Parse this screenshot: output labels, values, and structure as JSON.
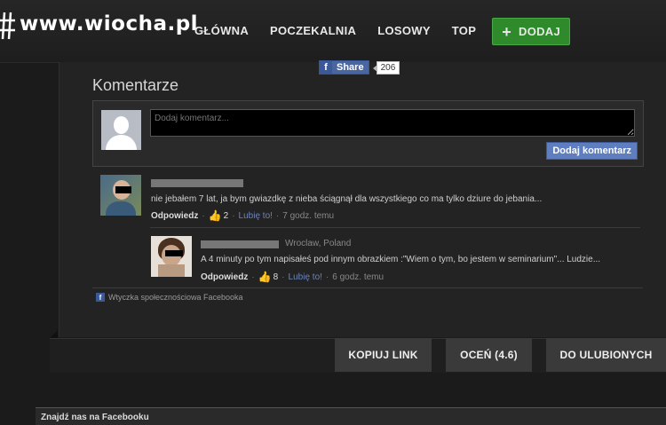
{
  "header": {
    "logo": "www.wiocha.pl",
    "nav": [
      "GŁÓWNA",
      "POCZEKALNIA",
      "LOSOWY",
      "TOP"
    ],
    "add_label": "DODAJ",
    "add_icon": "plus-icon"
  },
  "share": {
    "label": "Share",
    "count": "206",
    "icon": "facebook-icon"
  },
  "comments": {
    "title": "Komentarze",
    "placeholder": "Dodaj komentarz...",
    "submit_label": "Dodaj komentarz",
    "items": [
      {
        "text": "nie jebałem 7 lat, ja bym gwiazdkę z nieba ściągnął dla wszystkiego co ma tylko dziure do jebania...",
        "reply": "Odpowiedz",
        "likes": "2",
        "like_label": "Lubię to!",
        "time": "7 godz. temu"
      },
      {
        "location": "Wroclaw, Poland",
        "text": "A 4 minuty po tym napisałeś pod innym obrazkiem :\"Wiem o tym, bo jestem w seminarium\"... Ludzie...",
        "reply": "Odpowiedz",
        "likes": "8",
        "like_label": "Lubię to!",
        "time": "6 godz. temu"
      }
    ],
    "plugin_label": "Wtyczka społecznościowa Facebooka"
  },
  "actions": {
    "copy_link": "KOPIUJ LINK",
    "rate": "OCEŃ (4.6)",
    "favorite": "DO ULUBIONYCH"
  },
  "footer": {
    "text": "Znajdź nas na Facebooku"
  },
  "colors": {
    "add_green": "#2f8a2b",
    "facebook_blue": "#3b5998",
    "like_blue": "#6c84b8"
  }
}
